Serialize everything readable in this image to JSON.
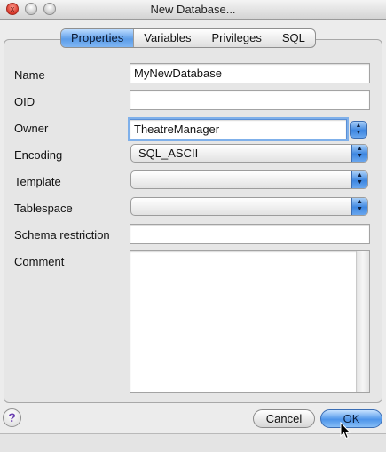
{
  "window": {
    "title": "New Database...",
    "close_mark": "x"
  },
  "tabs": [
    {
      "label": "Properties",
      "active": true
    },
    {
      "label": "Variables",
      "active": false
    },
    {
      "label": "Privileges",
      "active": false
    },
    {
      "label": "SQL",
      "active": false
    }
  ],
  "form": {
    "name": {
      "label": "Name",
      "value": "MyNewDatabase"
    },
    "oid": {
      "label": "OID",
      "value": ""
    },
    "owner": {
      "label": "Owner",
      "value": "TheatreManager"
    },
    "encoding": {
      "label": "Encoding",
      "value": "SQL_ASCII"
    },
    "template": {
      "label": "Template",
      "value": ""
    },
    "tablespace": {
      "label": "Tablespace",
      "value": ""
    },
    "schema_restriction": {
      "label": "Schema restriction",
      "value": ""
    },
    "comment": {
      "label": "Comment",
      "value": ""
    }
  },
  "buttons": {
    "help": "?",
    "cancel": "Cancel",
    "ok": "OK"
  },
  "colors": {
    "accent": "#5d9de8",
    "close": "#d8372a"
  }
}
